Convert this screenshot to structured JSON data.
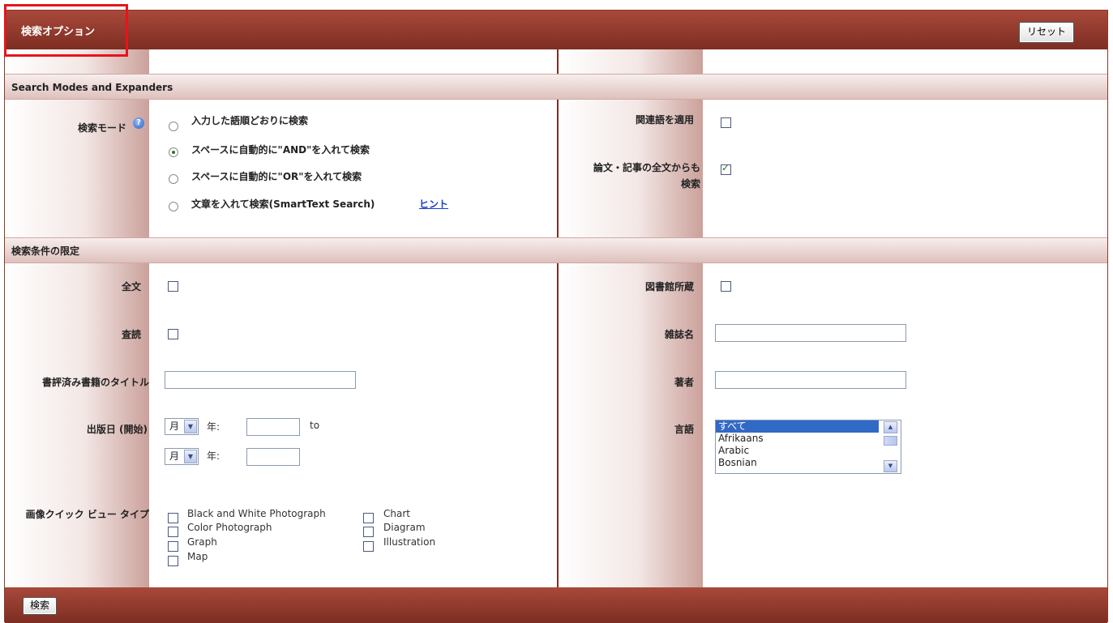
{
  "header": {
    "title": "検索オプション",
    "reset_label": "リセット"
  },
  "footer": {
    "search_label": "検索"
  },
  "search_modes": {
    "section_title": "Search Modes and Expanders",
    "mode_label": "検索モード",
    "help_icon": "help-question-icon",
    "options": [
      {
        "label": "入力した語順どおりに検索",
        "selected": false
      },
      {
        "label": "スペースに自動的に\"AND\"を入れて検索",
        "selected": true
      },
      {
        "label": "スペースに自動的に\"OR\"を入れて検索",
        "selected": false
      },
      {
        "label": "文章を入れて検索(SmartText Search)",
        "selected": false
      }
    ],
    "hint_link": "ヒント",
    "related_words_label": "関連語を適用",
    "related_words_checked": false,
    "fulltext_search_label_line1": "論文・記事の全文からも",
    "fulltext_search_label_line2": "検索",
    "fulltext_search_checked": true
  },
  "limiters": {
    "section_title": "検索条件の限定",
    "full_text_label": "全文",
    "full_text_checked": false,
    "peer_reviewed_label": "査読",
    "peer_reviewed_checked": false,
    "reviewed_book_title_label": "書評済み書籍のタイトル",
    "reviewed_book_title_value": "",
    "pub_date_label": "出版日 (開始)",
    "month_value": "月",
    "year_label": "年:",
    "to_label": "to",
    "image_types_label": "画像クイック ビュー タイプ",
    "image_types_col1": [
      "Black and White Photograph",
      "Color Photograph",
      "Graph",
      "Map"
    ],
    "image_types_col2": [
      "Chart",
      "Diagram",
      "Illustration"
    ],
    "library_holdings_label": "図書館所蔵",
    "library_holdings_checked": false,
    "journal_name_label": "雑誌名",
    "journal_name_value": "",
    "author_label": "著者",
    "author_value": "",
    "language_label": "言語",
    "language_options": [
      "すべて",
      "Afrikaans",
      "Arabic",
      "Bosnian"
    ],
    "language_selected": "すべて"
  },
  "colors": {
    "header_bg": "#8e3a2d",
    "accent": "#e8131b",
    "link": "#1a3fd0"
  }
}
